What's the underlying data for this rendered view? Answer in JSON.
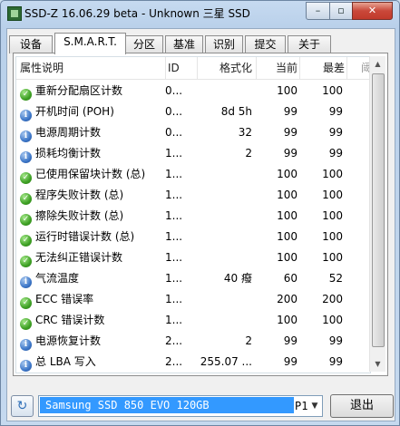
{
  "window": {
    "title": "SSD-Z 16.06.29 beta - Unknown 三星 SSD",
    "min_glyph": "–",
    "max_glyph": "▫",
    "close_glyph": "✕"
  },
  "tabs": [
    {
      "label": "设备",
      "active": false
    },
    {
      "label": "S.M.A.R.T.",
      "active": true
    },
    {
      "label": "分区",
      "active": false
    },
    {
      "label": "基准",
      "active": false
    },
    {
      "label": "识别",
      "active": false
    },
    {
      "label": "提交",
      "active": false
    },
    {
      "label": "关于",
      "active": false
    }
  ],
  "table": {
    "columns": {
      "name": "属性说明",
      "id": "ID",
      "formatted": "格式化",
      "current": "当前",
      "worst": "最差",
      "extra": "阈"
    },
    "rows": [
      {
        "icon": "ok",
        "name": "重新分配扇区计数",
        "id": "0...",
        "formatted": "",
        "current": "100",
        "worst": "100"
      },
      {
        "icon": "info",
        "name": "开机时间 (POH)",
        "id": "0...",
        "formatted": "8d 5h",
        "current": "99",
        "worst": "99"
      },
      {
        "icon": "info",
        "name": "电源周期计数",
        "id": "0...",
        "formatted": "32",
        "current": "99",
        "worst": "99"
      },
      {
        "icon": "info",
        "name": "损耗均衡计数",
        "id": "1...",
        "formatted": "2",
        "current": "99",
        "worst": "99"
      },
      {
        "icon": "ok",
        "name": "已使用保留块计数 (总)",
        "id": "1...",
        "formatted": "",
        "current": "100",
        "worst": "100"
      },
      {
        "icon": "ok",
        "name": "程序失败计数 (总)",
        "id": "1...",
        "formatted": "",
        "current": "100",
        "worst": "100"
      },
      {
        "icon": "ok",
        "name": "擦除失败计数 (总)",
        "id": "1...",
        "formatted": "",
        "current": "100",
        "worst": "100"
      },
      {
        "icon": "ok",
        "name": "运行时错误计数 (总)",
        "id": "1...",
        "formatted": "",
        "current": "100",
        "worst": "100"
      },
      {
        "icon": "ok",
        "name": "无法纠正错误计数",
        "id": "1...",
        "formatted": "",
        "current": "100",
        "worst": "100"
      },
      {
        "icon": "info",
        "name": "气流温度",
        "id": "1...",
        "formatted": "40 癈",
        "current": "60",
        "worst": "52"
      },
      {
        "icon": "ok",
        "name": "ECC 错误率",
        "id": "1...",
        "formatted": "",
        "current": "200",
        "worst": "200"
      },
      {
        "icon": "ok",
        "name": "CRC 错误计数",
        "id": "1...",
        "formatted": "",
        "current": "100",
        "worst": "100"
      },
      {
        "icon": "info",
        "name": "电源恢复计数",
        "id": "2...",
        "formatted": "2",
        "current": "99",
        "worst": "99"
      },
      {
        "icon": "info",
        "name": "总 LBA 写入",
        "id": "2...",
        "formatted": "255.07 ...",
        "current": "99",
        "worst": "99"
      }
    ]
  },
  "bottom": {
    "refresh_glyph": "↻",
    "drive_label": "Samsung SSD 850 EVO 120GB",
    "drive_extra": "P1",
    "dropdown_glyph": "▼",
    "exit_label": "退出"
  },
  "colors": {
    "ok": "#3ea024",
    "info": "#3d77c8",
    "selection": "#3399ff",
    "frame": "#c6daf0"
  },
  "icons": {
    "ok": "check-circle-icon",
    "info": "info-circle-icon"
  }
}
